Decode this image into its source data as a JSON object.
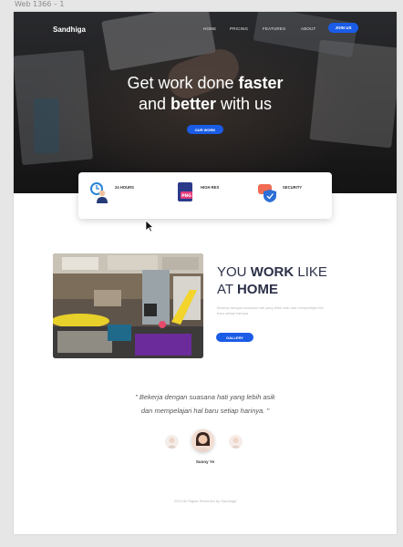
{
  "canvas": {
    "artboard_label": "Web 1366 – 1"
  },
  "nav": {
    "logo": "Sandhiga",
    "items": [
      "HOME",
      "PRICING",
      "FEATURES",
      "ABOUT"
    ],
    "join_label": "JOIN US"
  },
  "hero": {
    "title_line1_normal": "Get work done ",
    "title_line1_bold": "faster",
    "title_line2_normal1": "and ",
    "title_line2_bold": "better",
    "title_line2_normal2": " with us",
    "cta_label": "OUR WORK"
  },
  "features": [
    {
      "title": "24 HOURS",
      "icon": "clock-person-icon"
    },
    {
      "title": "HIGH RES",
      "icon": "png-file-icon"
    },
    {
      "title": "SECURITY",
      "icon": "shield-chat-icon"
    }
  ],
  "work": {
    "title_p1": "YOU ",
    "title_bold1": "WORK",
    "title_p2": " LIKE",
    "title_p3": "AT ",
    "title_bold2": "HOME",
    "description": "Bekerja dengan suasana hati yang lebih asik dan mempelajari hal baru setiap harinya.",
    "button_label": "GALLERY"
  },
  "testimonial": {
    "quote_line1": "\" Bekerja dengan suasana hati yang lebih asik",
    "quote_line2": "dan mempelajari hal baru setiap harinya. \"",
    "name": "Sunny Ye"
  },
  "footer": {
    "text": "2019 All Rights Reserved by Sandhiga"
  },
  "colors": {
    "accent": "#1a5ce6",
    "heading": "#2c3148"
  }
}
